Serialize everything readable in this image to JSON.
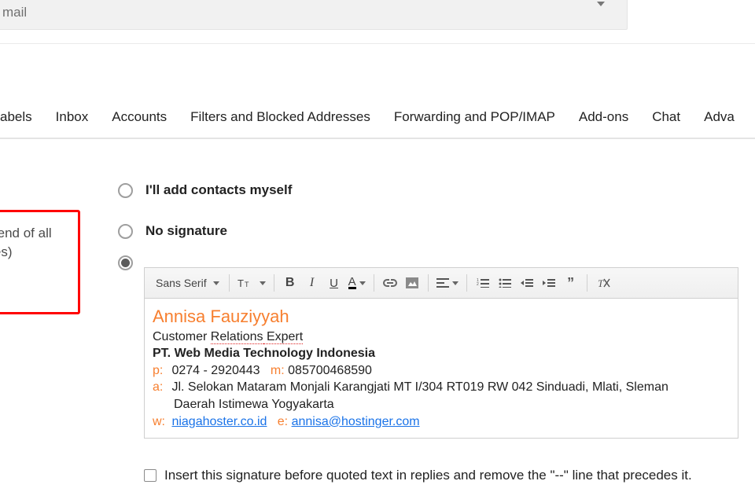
{
  "topbar": {
    "text": "mail"
  },
  "tabs": {
    "items": [
      "abels",
      "Inbox",
      "Accounts",
      "Filters and Blocked Addresses",
      "Forwarding and POP/IMAP",
      "Add-ons",
      "Chat",
      "Adva"
    ]
  },
  "left_hint": {
    "line1": "he end of all",
    "line2": "ages)"
  },
  "options": {
    "add_contacts": "I'll add contacts myself",
    "no_signature": "No signature"
  },
  "toolbar": {
    "font": "Sans Serif"
  },
  "signature": {
    "name": "Annisa Fauziyyah",
    "role_a": "Customer ",
    "role_b": "Relations",
    "role_c": " Expert",
    "company": "PT. Web Media Technology Indonesia",
    "p": "0274 - 2920443",
    "m": "085700468590",
    "addr1": "Jl. Selokan Mataram Monjali Karangjati MT I/304 RT019 RW 042 Sinduadi, Mlati, Sleman",
    "addr2": "Daerah Istimewa Yogyakarta",
    "web": "niagahoster.co.id",
    "email": "annisa@hostinger.com",
    "labels": {
      "p": "p:",
      "m": "m:",
      "a": "a:",
      "w": "w:",
      "e": "e:"
    }
  },
  "insert_before": "Insert this signature before quoted text in replies and remove the \"--\" line that precedes it."
}
